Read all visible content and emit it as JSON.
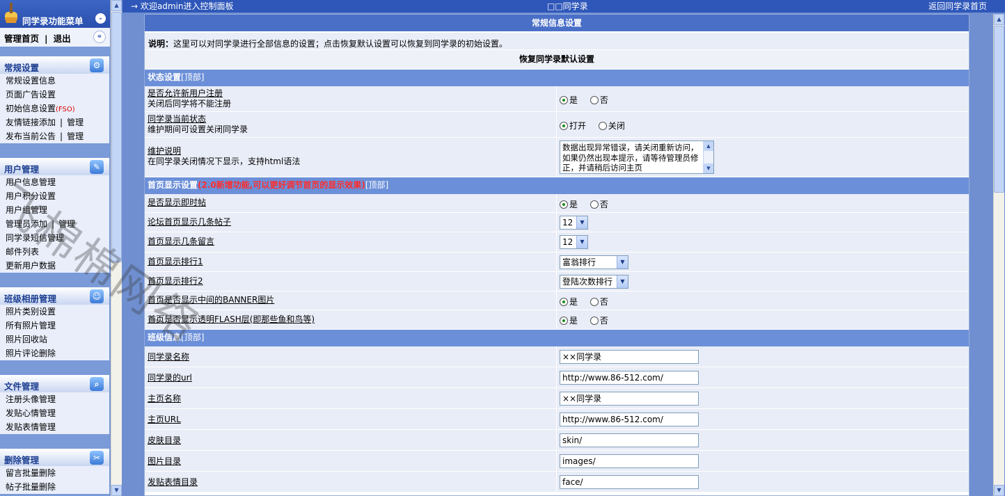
{
  "side": {
    "title": "同学录功能菜单",
    "home": "管理首页",
    "logout": "退出",
    "sections": [
      {
        "title": "常规设置",
        "icon": "settings-icon",
        "items": [
          {
            "label": "常规设置信息"
          },
          {
            "label": "页面广告设置"
          },
          {
            "label": "初始信息设置",
            "tag": "(FSO)"
          },
          {
            "label": "友情链接添加",
            "extra": "管理"
          },
          {
            "label": "发布当前公告",
            "extra": "管理"
          }
        ]
      },
      {
        "title": "用户管理",
        "icon": "user-notes-icon",
        "items": [
          {
            "label": "用户信息管理"
          },
          {
            "label": "用户积分设置"
          },
          {
            "label": "用户组管理"
          },
          {
            "label": "管理员添加",
            "extra": "管理"
          },
          {
            "label": "同学录短信管理"
          },
          {
            "label": "邮件列表"
          },
          {
            "label": "更新用户数据"
          }
        ]
      },
      {
        "title": "班级相册管理",
        "icon": "people-icon",
        "items": [
          {
            "label": "照片类别设置"
          },
          {
            "label": "所有照片管理"
          },
          {
            "label": "照片回收站"
          },
          {
            "label": "照片评论删除"
          }
        ]
      },
      {
        "title": "文件管理",
        "icon": "magnifier-icon",
        "items": [
          {
            "label": "注册头像管理"
          },
          {
            "label": "发贴心情管理"
          },
          {
            "label": "发贴表情管理"
          }
        ]
      },
      {
        "title": "删除管理",
        "icon": "tools-icon",
        "items": [
          {
            "label": "留言批量删除"
          },
          {
            "label": "帖子批量删除"
          }
        ]
      }
    ]
  },
  "topbar": {
    "welcome": "→ 欢迎admin进入控制面板",
    "site": "□□同学录",
    "home": "返回同学录首页"
  },
  "panel": {
    "title": "常规信息设置",
    "note_label": "说明：",
    "note": "这里可以对同学录进行全部信息的设置；点击恢复默认设置可以恢复到同学录的初始设置。",
    "restore": "恢复同学录默认设置"
  },
  "sec1": {
    "title": "状态设置",
    "top": "[顶部]",
    "rows": [
      {
        "title": "是否允许新用户注册",
        "desc": "关闭后同学将不能注册",
        "opts": [
          "是",
          "否"
        ]
      },
      {
        "title": "同学录当前状态",
        "desc": "维护期间可设置关闭同学录",
        "opts": [
          "打开",
          "关闭"
        ]
      },
      {
        "title": "维护说明",
        "desc": "在同学录关闭情况下显示，支持html语法",
        "text": "数据出现异常错误，请关闭重新访问，如果仍然出现本提示，请等待管理员修正，并请稍后访问主页"
      }
    ]
  },
  "sec2": {
    "title": "首页显示设置",
    "highlight": "(2.0新增功能,可以更好调节首页的显示效果)",
    "top": "[顶部]",
    "rows": [
      {
        "title": "是否显示即时帖",
        "opts": [
          "是",
          "否"
        ]
      },
      {
        "title": "论坛首页显示几条帖子",
        "value": "12"
      },
      {
        "title": "首页显示几条留言",
        "value": "12"
      },
      {
        "title": "首页显示排行1",
        "value": "富翁排行"
      },
      {
        "title": "首页显示排行2",
        "value": "登陆次数排行"
      },
      {
        "title": "首页是否显示中间的BANNER图片",
        "opts": [
          "是",
          "否"
        ]
      },
      {
        "title": "首页是否显示透明FLASH层(即那些鱼和鸟等)",
        "opts": [
          "是",
          "否"
        ]
      }
    ]
  },
  "sec3": {
    "title": "班级信息",
    "top": "[顶部]",
    "rows": [
      {
        "title": "同学录名称",
        "value": "××同学录"
      },
      {
        "title": "同学录的url",
        "value": "http://www.86-512.com/"
      },
      {
        "title": "主页名称",
        "value": "××同学录"
      },
      {
        "title": "主页URL",
        "value": "http://www.86-512.com/"
      },
      {
        "title": "皮肤目录",
        "value": "skin/"
      },
      {
        "title": "图片目录",
        "value": "images/"
      },
      {
        "title": "发贴表情目录",
        "value": "face/"
      }
    ]
  },
  "watermark": "飞棉棉网络"
}
